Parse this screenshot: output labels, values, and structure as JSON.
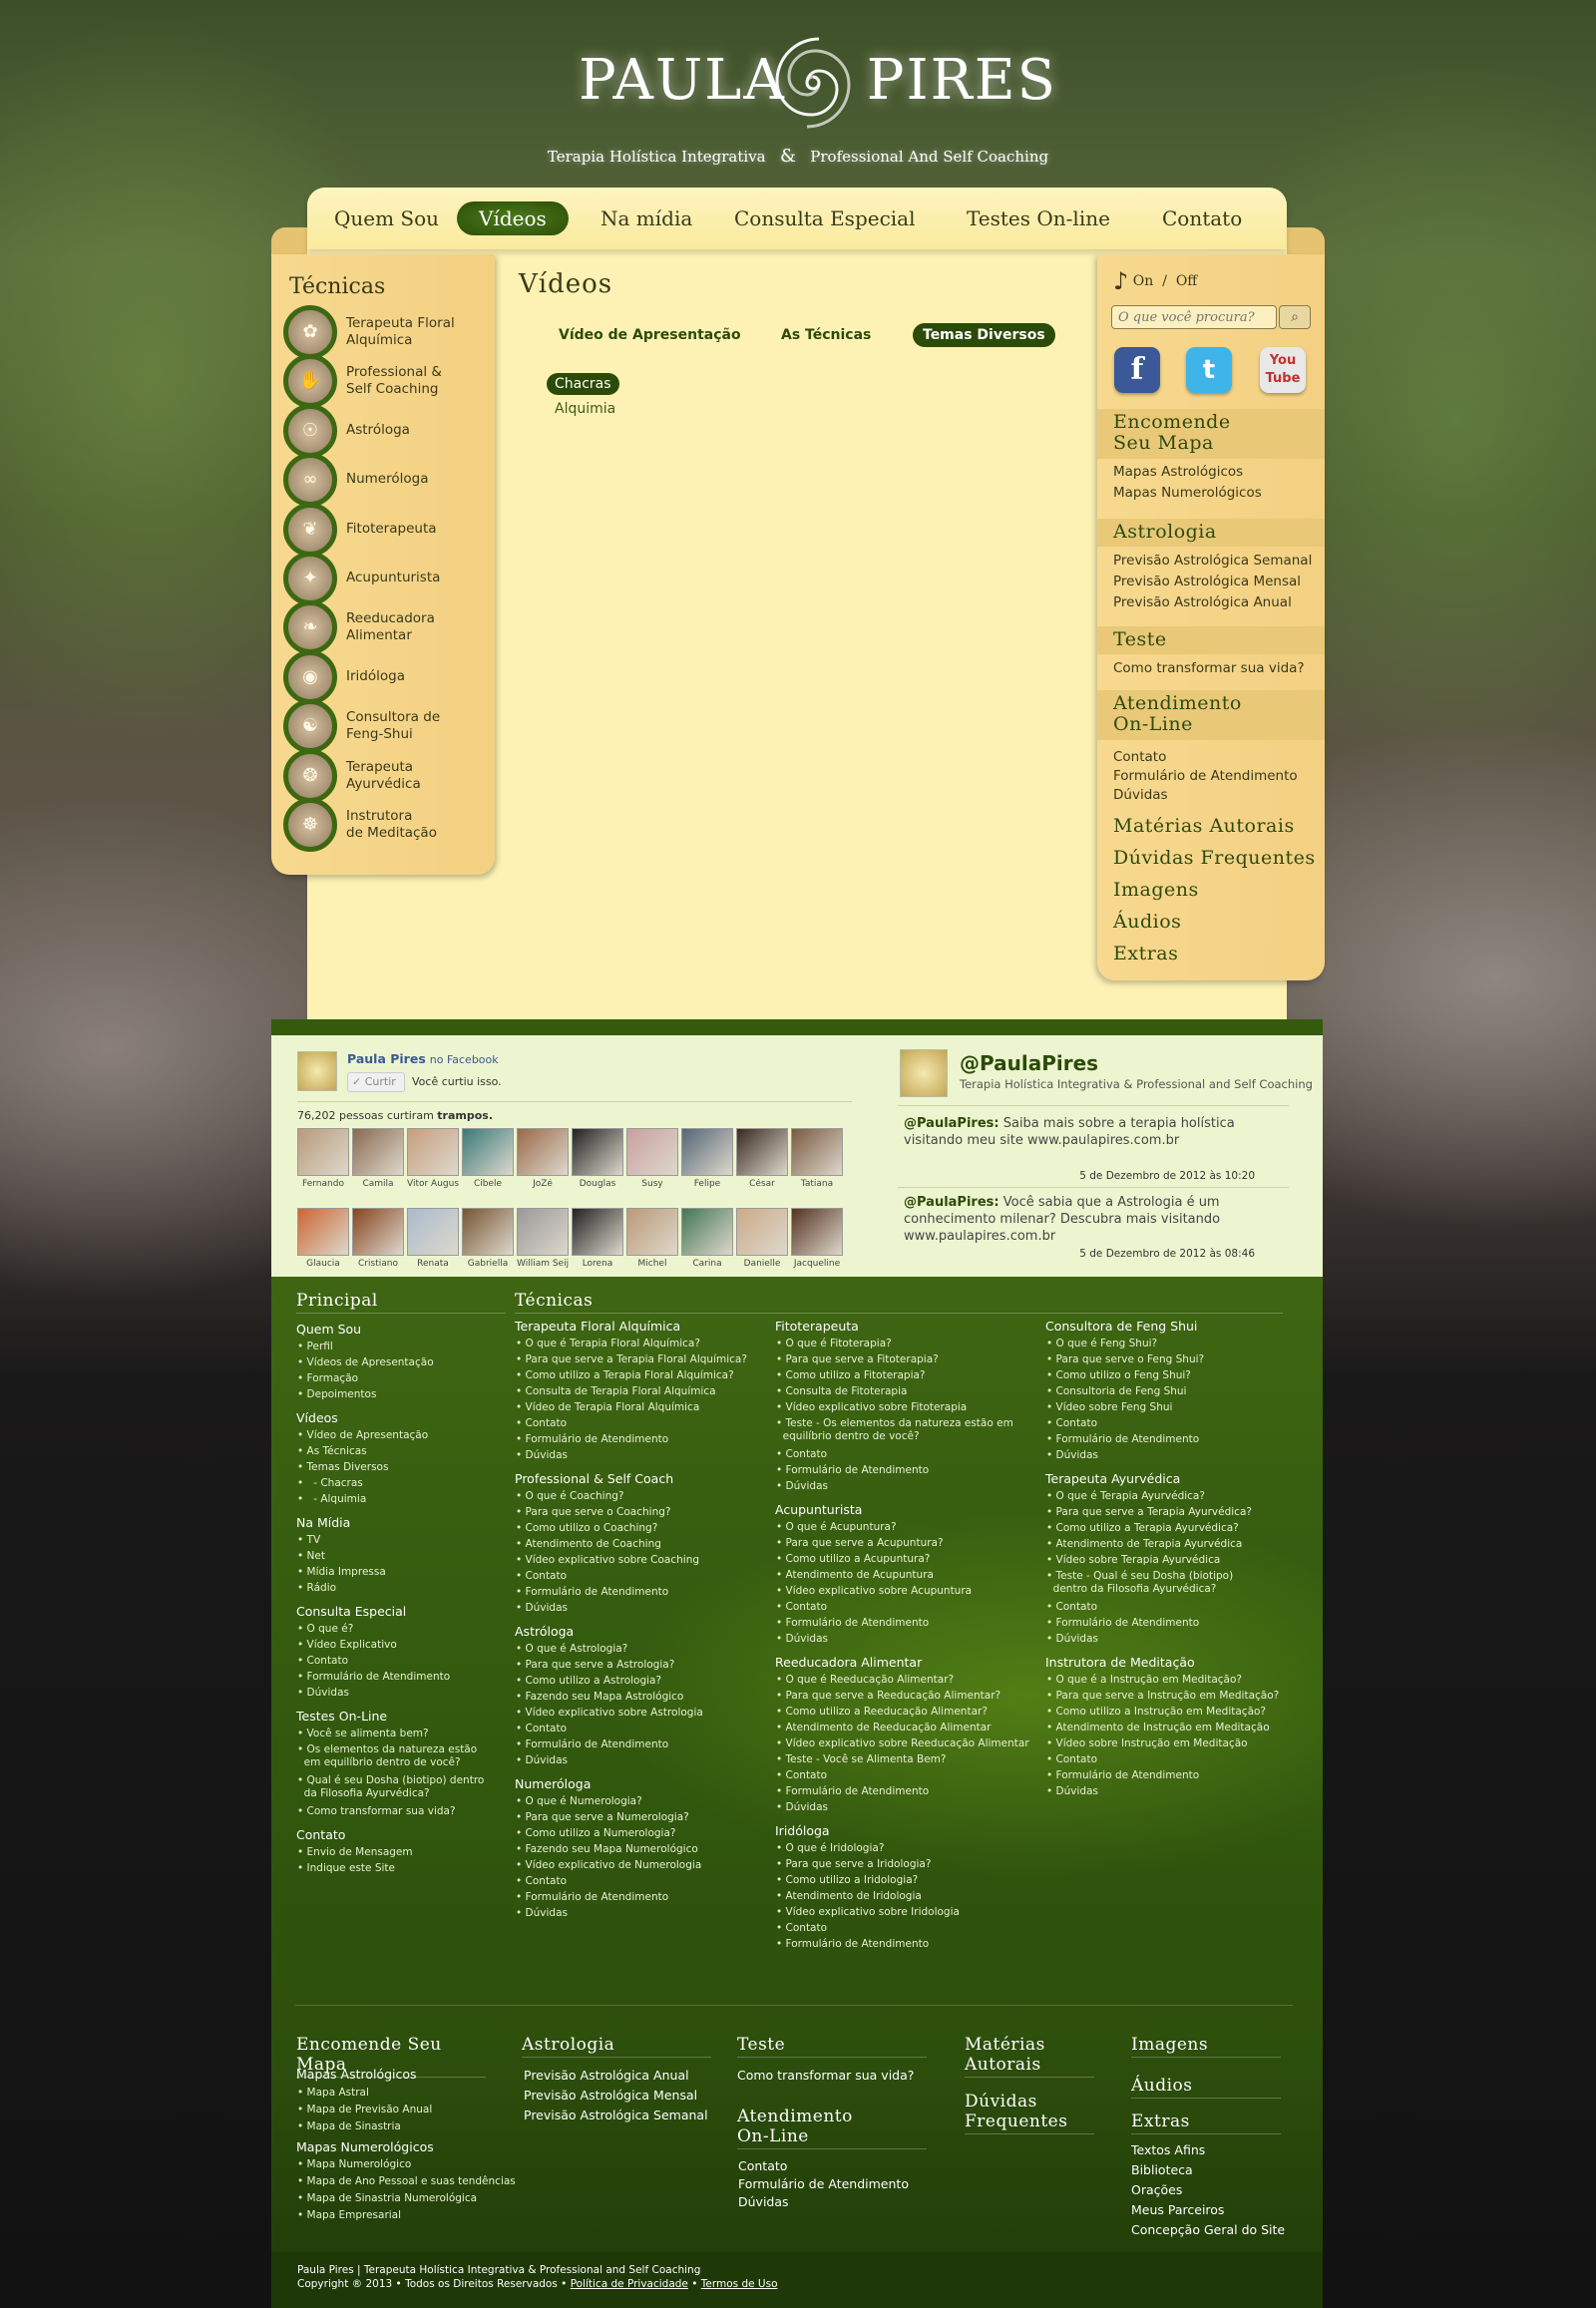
{
  "header": {
    "logo_left": "PAULA",
    "logo_right": "PIRES",
    "tagline_left": "Terapia Holística Integrativa",
    "tagline_amp": "&",
    "tagline_right": "Professional And Self Coaching"
  },
  "nav": [
    {
      "label": "Quem Sou",
      "active": false
    },
    {
      "label": "Vídeos",
      "active": true
    },
    {
      "label": "Na mídia",
      "active": false
    },
    {
      "label": "Consulta Especial",
      "active": false
    },
    {
      "label": "Testes On-line",
      "active": false
    },
    {
      "label": "Contato",
      "active": false
    }
  ],
  "left_sidebar": {
    "title": "Técnicas",
    "items": [
      {
        "label": "Terapeuta Floral\nAlquímica",
        "icon": "floral-icon"
      },
      {
        "label": "Professional &\nSelf Coaching",
        "icon": "coaching-icon"
      },
      {
        "label": "Astróloga",
        "icon": "astrology-icon"
      },
      {
        "label": "Numeróloga",
        "icon": "numerology-icon"
      },
      {
        "label": "Fitoterapeuta",
        "icon": "herbal-icon"
      },
      {
        "label": "Acupunturista",
        "icon": "acupuncture-icon"
      },
      {
        "label": "Reeducadora\nAlimentar",
        "icon": "food-icon"
      },
      {
        "label": "Iridóloga",
        "icon": "eye-icon"
      },
      {
        "label": "Consultora de\nFeng-Shui",
        "icon": "fengshui-icon"
      },
      {
        "label": "Terapeuta\nAyurvédica",
        "icon": "ayurveda-icon"
      },
      {
        "label": "Instrutora\nde Meditação",
        "icon": "meditation-icon"
      }
    ]
  },
  "content": {
    "title": "Vídeos",
    "tabs": [
      {
        "label": "Vídeo de Apresentação",
        "active": false
      },
      {
        "label": "As Técnicas",
        "active": false
      },
      {
        "label": "Temas Diversos",
        "active": true
      }
    ],
    "subitems": [
      {
        "label": "Chacras",
        "active": true
      },
      {
        "label": "Alquimia",
        "active": false
      }
    ]
  },
  "right_sidebar": {
    "music_on": "On",
    "music_sep": "/",
    "music_off": "Off",
    "search_placeholder": "O que você procura?",
    "social": [
      {
        "label": "f",
        "name": "Facebook",
        "color": "#3b5998"
      },
      {
        "label": "t",
        "name": "Twitter",
        "color": "#3fb4e8"
      },
      {
        "label": "You Tube",
        "name": "YouTube",
        "color": "#d8d8d8"
      }
    ],
    "sections": [
      {
        "title": "Encomende\nSeu Mapa",
        "links": [
          "Mapas Astrológicos",
          "Mapas Numerológicos"
        ]
      },
      {
        "title": "Astrologia",
        "links": [
          "Previsão Astrológica Semanal",
          "Previsão Astrológica Mensal",
          "Previsão Astrológica Anual"
        ]
      },
      {
        "title": "Teste",
        "links": [
          "Como transformar sua vida?"
        ]
      },
      {
        "title": "Atendimento\nOn-Line",
        "links": [
          "Contato",
          "Formulário de Atendimento",
          "Dúvidas"
        ]
      }
    ],
    "plain_links": [
      "Matérias Autorais",
      "Dúvidas Frequentes",
      "Imagens",
      "Áudios",
      "Extras"
    ]
  },
  "facebook": {
    "name": "Paula Pires",
    "on": "no Facebook",
    "like_button": "Curtir",
    "liked_text": "Você curtiu isso.",
    "count_text": "76,202 pessoas curtiram",
    "count_bold": "trampos.",
    "fans": [
      "Fernando",
      "Camila",
      "Vitor Augus",
      "Cibele",
      "JoZé",
      "Douglas",
      "Susy",
      "Felipe",
      "César",
      "Tatiana",
      "Glaucia",
      "Cristiano",
      "Renata",
      "Gabriella",
      "William Seij",
      "Lorena",
      "Michel",
      "Carina",
      "Danielle",
      "Jacqueline"
    ]
  },
  "twitter": {
    "handle": "@PaulaPires",
    "subtitle": "Terapia Holística Integrativa & Professional and Self Coaching",
    "tweets": [
      {
        "author": "@PaulaPires:",
        "text": " Saiba mais sobre a terapia holística visitando meu site www.paulapires.com.br",
        "date": "5 de Dezembro de 2012 às 10:20"
      },
      {
        "author": "@PaulaPires:",
        "text": " Você sabia que a Astrologia é um conhecimento milenar? Descubra mais visitando www.paulapires.com.br",
        "date": "5 de Dezembro de 2012 às 08:46"
      }
    ]
  },
  "footer": {
    "principal_title": "Principal",
    "principal": [
      {
        "title": "Quem Sou",
        "items": [
          "Perfil",
          "Vídeos de Apresentação",
          "Formação",
          "Depoimentos"
        ]
      },
      {
        "title": "Vídeos",
        "items": [
          "Vídeo de Apresentação",
          "As Técnicas",
          "Temas Diversos",
          "  - Chacras",
          "  - Alquimia"
        ]
      },
      {
        "title": "Na Mídia",
        "items": [
          "TV",
          "Net",
          "Mídia Impressa",
          "Rádio"
        ]
      },
      {
        "title": "Consulta Especial",
        "items": [
          "O que é?",
          "Vídeo Explicativo",
          "Contato",
          "Formulário de Atendimento",
          "Dúvidas"
        ]
      },
      {
        "title": "Testes On-Line",
        "items": [
          "Você se alimenta bem?",
          "Os elementos da natureza estão\n  em equilíbrio dentro de você?",
          "Qual é seu Dosha (biotipo) dentro\n  da Filosofia Ayurvédica?",
          "Como transformar sua vida?"
        ]
      },
      {
        "title": "Contato",
        "items": [
          "Envio de Mensagem",
          "Indique este Site"
        ]
      }
    ],
    "tecnicas_title": "Técnicas",
    "col1": [
      {
        "title": "Terapeuta Floral Alquímica",
        "items": [
          "O que é Terapia Floral Alquímica?",
          "Para que serve a Terapia Floral Alquímica?",
          "Como utilizo a Terapia Floral Alquímica?",
          "Consulta de Terapia Floral Alquímica",
          "Vídeo de Terapia Floral Alquímica",
          "Contato",
          "Formulário de Atendimento",
          "Dúvidas"
        ]
      },
      {
        "title": "Professional & Self Coach",
        "items": [
          "O que é Coaching?",
          "Para que serve o Coaching?",
          "Como utilizo o Coaching?",
          "Atendimento de Coaching",
          "Vídeo explicativo sobre Coaching",
          "Contato",
          "Formulário de Atendimento",
          "Dúvidas"
        ]
      },
      {
        "title": "Astróloga",
        "items": [
          "O que é Astrologia?",
          "Para que serve a Astrologia?",
          "Como utilizo a Astrologia?",
          "Fazendo seu Mapa Astrológico",
          "Vídeo explicativo sobre Astrologia",
          "Contato",
          "Formulário de Atendimento",
          "Dúvidas"
        ]
      },
      {
        "title": "Numeróloga",
        "items": [
          "O que é Numerologia?",
          "Para que serve a Numerologia?",
          "Como utilizo a Numerologia?",
          "Fazendo seu Mapa Numerológico",
          "Vídeo explicativo de Numerologia",
          "Contato",
          "Formulário de Atendimento",
          "Dúvidas"
        ]
      }
    ],
    "col2": [
      {
        "title": "Fitoterapeuta",
        "items": [
          "O que é Fitoterapia?",
          "Para que serve a Fitoterapia?",
          "Como utilizo a Fitoterapia?",
          "Consulta de Fitoterapia",
          "Vídeo explicativo sobre Fitoterapia",
          "Teste - Os elementos da natureza estão em\n  equilíbrio dentro de você?",
          "Contato",
          "Formulário de Atendimento",
          "Dúvidas"
        ]
      },
      {
        "title": "Acupunturista",
        "items": [
          "O que é Acupuntura?",
          "Para que serve a Acupuntura?",
          "Como utilizo a Acupuntura?",
          "Atendimento de Acupuntura",
          "Vídeo explicativo sobre Acupuntura",
          "Contato",
          "Formulário de Atendimento",
          "Dúvidas"
        ]
      },
      {
        "title": "Reeducadora Alimentar",
        "items": [
          "O que é Reeducação Alimentar?",
          "Para que serve a Reeducação Alimentar?",
          "Como utilizo a Reeducação Alimentar?",
          "Atendimento de Reeducação Alimentar",
          "Vídeo explicativo sobre Reeducação Alimentar",
          "Teste - Você se Alimenta Bem?",
          "Contato",
          "Formulário de Atendimento",
          "Dúvidas"
        ]
      },
      {
        "title": "Iridóloga",
        "items": [
          "O que é Iridologia?",
          "Para que serve a Iridologia?",
          "Como utilizo a Iridologia?",
          "Atendimento de Iridologia",
          "Vídeo explicativo sobre Iridologia",
          "Contato",
          "Formulário de Atendimento"
        ]
      }
    ],
    "col3": [
      {
        "title": "Consultora de Feng Shui",
        "items": [
          "O que é Feng Shui?",
          "Para que serve o Feng Shui?",
          "Como utilizo o Feng Shui?",
          "Consultoria de Feng Shui",
          "Vídeo sobre Feng Shui",
          "Contato",
          "Formulário de Atendimento",
          "Dúvidas"
        ]
      },
      {
        "title": "Terapeuta Ayurvédica",
        "items": [
          "O que é Terapia Ayurvédica?",
          "Para que serve a Terapia Ayurvédica?",
          "Como utilizo a Terapia Ayurvédica?",
          "Atendimento de Terapia Ayurvédica",
          "Vídeo sobre Terapia Ayurvédica",
          "Teste - Qual é seu Dosha (biotipo)\n  dentro da Filosofia Ayurvédica?",
          "Contato",
          "Formulário de Atendimento",
          "Dúvidas"
        ]
      },
      {
        "title": "Instrutora de Meditação",
        "items": [
          "O que é a Instrução em Meditação?",
          "Para que serve a Instrução em Meditação?",
          "Como utilizo a Instrução em Meditação?",
          "Atendimento de Instrução em Meditação",
          "Vídeo sobre Instrução em Meditação",
          "Contato",
          "Formulário de Atendimento",
          "Dúvidas"
        ]
      }
    ],
    "bottom": {
      "mapa_title": "Encomende Seu Mapa",
      "mapa_astro": "Mapas Astrológicos",
      "mapa_astro_items": [
        "Mapa Astral",
        "Mapa de Previsão Anual",
        "Mapa de Sinastria"
      ],
      "mapa_num": "Mapas Numerológicos",
      "mapa_num_items": [
        "Mapa Numerológico",
        "Mapa de Ano Pessoal e suas tendências",
        "Mapa de Sinastria Numerológica",
        "Mapa Empresarial"
      ],
      "astro_title": "Astrologia",
      "astro_items": [
        "Previsão Astrológica Anual",
        "Previsão Astrológica Mensal",
        "Previsão Astrológica Semanal"
      ],
      "teste_title": "Teste",
      "teste_items": [
        "Como transformar sua vida?"
      ],
      "atend_title": "Atendimento\nOn-Line",
      "atend_items": [
        "Contato",
        "Formulário de Atendimento",
        "Dúvidas"
      ],
      "materias_title": "Matérias\nAutorais",
      "duvidas_title": "Dúvidas\nFrequentes",
      "imagens_title": "Imagens",
      "audios_title": "Áudios",
      "extras_title": "Extras",
      "extras_items": [
        "Textos Afins",
        "Biblioteca",
        "Orações",
        "Meus Parceiros",
        "Concepção Geral do Site"
      ]
    },
    "copyright_line1": "Paula Pires | Terapeuta Holística Integrativa & Professional and Self Coaching",
    "copyright_line2": "Copyright ® 2013 • Todos os Direitos Reservados •",
    "privacy_link": "Política de Privacidade",
    "terms_link": "Termos de Uso",
    "bullet_sep": "•"
  }
}
